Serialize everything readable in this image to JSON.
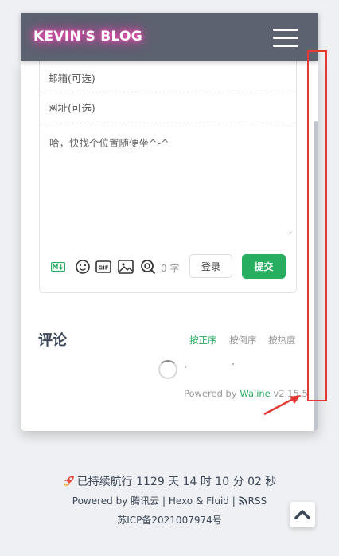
{
  "navbar": {
    "brand": "KEVIN'S BLOG",
    "menu_icon": "hamburger-menu-icon"
  },
  "comment_form": {
    "email_placeholder": "邮箱(可选)",
    "url_placeholder": "网址(可选)",
    "content_placeholder": "哈，快找个位置随便坐^-^",
    "toolbar_icons": [
      "markdown-icon",
      "emoji-icon",
      "gif-icon",
      "image-icon",
      "preview-icon"
    ],
    "word_count": "0",
    "word_unit": "字",
    "login_label": "登录",
    "submit_label": "提交",
    "accent_color": "#27ae60"
  },
  "comments": {
    "title": "评论",
    "sort_options": [
      {
        "label": "按正序",
        "active": true
      },
      {
        "label": "按倒序",
        "active": false
      },
      {
        "label": "按热度",
        "active": false
      }
    ],
    "powered_prefix": "Powered by",
    "powered_name": "Waline",
    "powered_version": "v2.15.5"
  },
  "footer": {
    "uptime": "已持续航行 1129 天 14 时 10 分 02 秒",
    "powered_prefix": "Powered by",
    "host": "腾讯云",
    "sep1": "|",
    "theme": "Hexo & Fluid",
    "sep2": "|",
    "rss": "RSS",
    "icp": "苏ICP备2021007974号"
  },
  "annotation": {
    "color": "#e53935"
  }
}
